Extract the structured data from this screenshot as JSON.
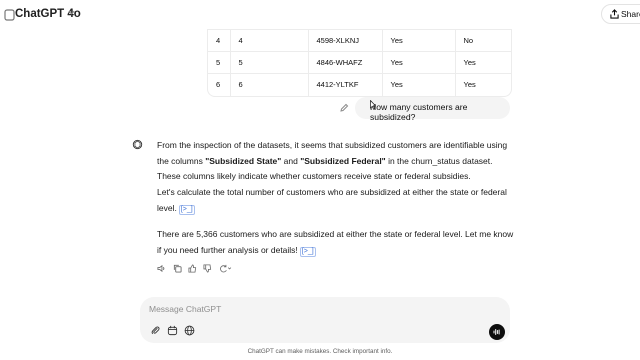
{
  "header": {
    "model_name": "ChatGPT 4o",
    "share_label": "Share"
  },
  "table": {
    "rows": [
      [
        "4",
        "4",
        "4598-XLKNJ",
        "Yes",
        "No"
      ],
      [
        "5",
        "5",
        "4846-WHAFZ",
        "Yes",
        "Yes"
      ],
      [
        "6",
        "6",
        "4412-YLTKF",
        "Yes",
        "Yes"
      ]
    ]
  },
  "user_message": "How many customers are subsidized?",
  "assistant": {
    "p1_a": "From the inspection of the datasets, it seems that subsidized customers are identifiable using the columns ",
    "p1_b1": "\"Subsidized State\"",
    "p1_and": " and ",
    "p1_b2": "\"Subsidized Federal\"",
    "p1_c": " in the churn_status dataset. These columns likely indicate whether customers receive state or federal subsidies.",
    "p2": "Let's calculate the total number of customers who are subsidized at either the state or federal level.",
    "p3": "There are 5,366 customers who are subsidized at either the state or federal level. Let me know if you need further analysis or details!",
    "citation": "[>_]"
  },
  "composer": {
    "placeholder": "Message ChatGPT"
  },
  "footer_note": "ChatGPT can make mistakes. Check important info.",
  "colors": {
    "user_bubble": "#f4f4f4",
    "composer": "#f4f4f4",
    "citation": "#3b6fd4"
  },
  "icons": [
    "sidebar-icon",
    "chevron-down-icon",
    "share-icon",
    "edit-icon",
    "openai-logo-icon",
    "speaker-icon",
    "copy-icon",
    "thumbs-up-icon",
    "thumbs-down-icon",
    "regenerate-icon",
    "attach-icon",
    "tools-icon",
    "globe-icon",
    "voice-icon"
  ]
}
